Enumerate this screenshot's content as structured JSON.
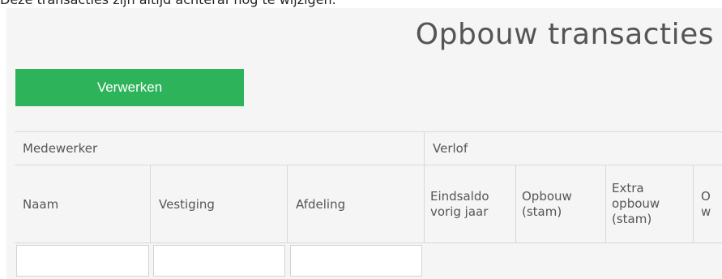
{
  "top_note": "Deze transacties zijn altijd achteraf nog te wijzigen.",
  "page_title": "Opbouw transacties",
  "process_button_label": "Verwerken",
  "table": {
    "groups": [
      "Medewerker",
      "Verlof"
    ],
    "columns": [
      "Naam",
      "Vestiging",
      "Afdeling",
      "Eindsaldo vorig jaar",
      "Opbouw (stam)",
      "Extra opbouw (stam)",
      "O w"
    ],
    "filters": {
      "naam": "",
      "vestiging": "",
      "afdeling": ""
    }
  }
}
